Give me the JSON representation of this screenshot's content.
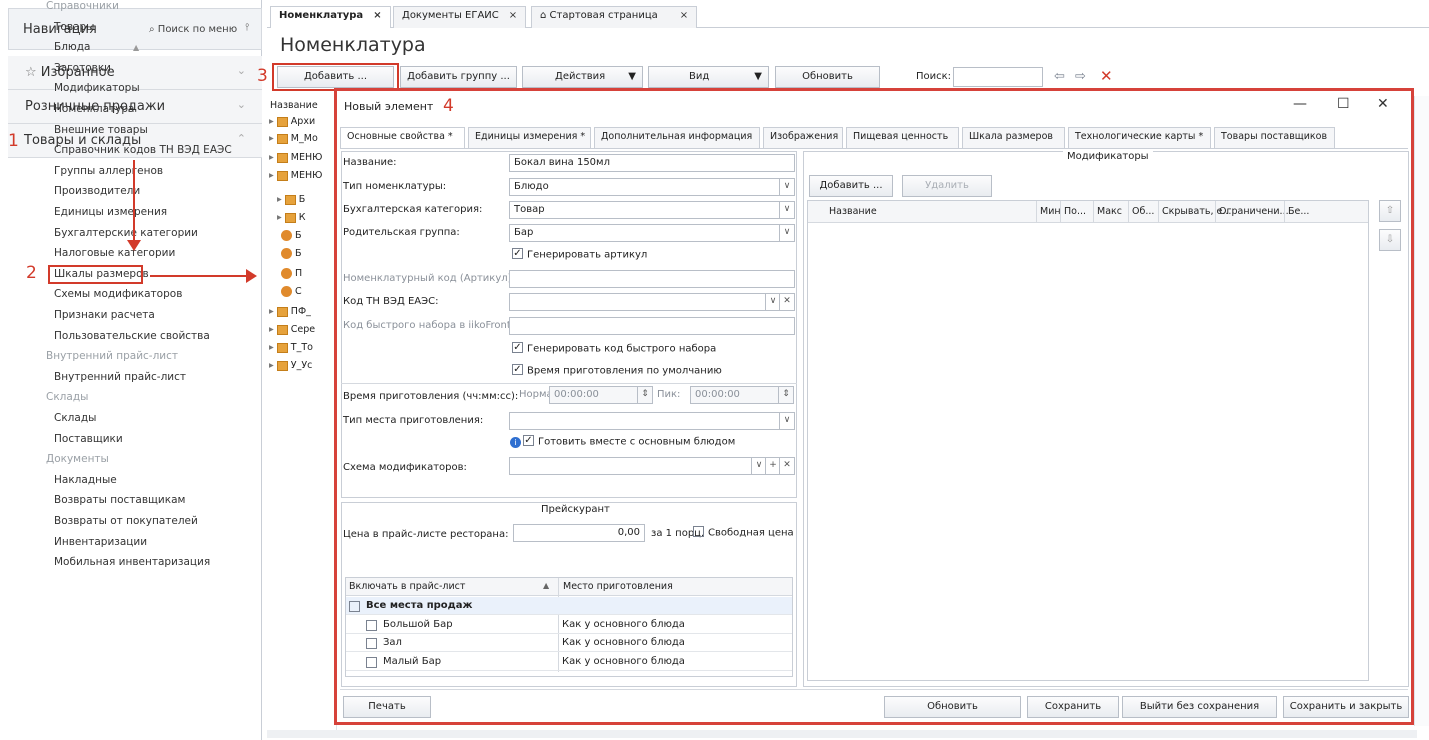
{
  "nav": {
    "title": "Навигация",
    "search": "Поиск по меню",
    "favorites": "Избранное",
    "retail": "Розничные продажи",
    "goods": "Товары и склады",
    "items": [
      {
        "label": "Справочники",
        "group": true
      },
      {
        "label": "Товары"
      },
      {
        "label": "Блюда"
      },
      {
        "label": "Заготовки"
      },
      {
        "label": "Модификаторы"
      },
      {
        "label": "Номенклатура"
      },
      {
        "label": "Внешние товары"
      },
      {
        "label": "Справочник кодов ТН ВЭД ЕАЭС"
      },
      {
        "label": "Группы аллергенов"
      },
      {
        "label": "Производители"
      },
      {
        "label": "Единицы измерения"
      },
      {
        "label": "Бухгалтерские категории"
      },
      {
        "label": "Налоговые категории"
      },
      {
        "label": "Шкалы размеров"
      },
      {
        "label": "Схемы модификаторов"
      },
      {
        "label": "Признаки расчета"
      },
      {
        "label": "Пользовательские свойства"
      },
      {
        "label": "Внутренний прайс-лист",
        "group": true
      },
      {
        "label": "Внутренний прайс-лист"
      },
      {
        "label": "Склады",
        "group": true
      },
      {
        "label": "Склады"
      },
      {
        "label": "Поставщики"
      },
      {
        "label": "Документы",
        "group": true
      },
      {
        "label": "Накладные"
      },
      {
        "label": "Возвраты поставщикам"
      },
      {
        "label": "Возвраты от покупателей"
      },
      {
        "label": "Инвентаризации"
      },
      {
        "label": "Мобильная инвентаризация"
      }
    ]
  },
  "annotations": {
    "n1": "1",
    "n2": "2",
    "n3": "3",
    "n4": "4"
  },
  "tabs": [
    "Номенклатура",
    "Документы ЕГАИС",
    "Стартовая страница"
  ],
  "tab_close": "×",
  "page_title": "Номенклатура",
  "toolbar": {
    "add": "Добавить ...",
    "add_group": "Добавить группу ...",
    "actions": "Действия",
    "view": "Вид",
    "refresh": "Обновить",
    "search_label": "Поиск:"
  },
  "tree": {
    "header": "Название",
    "rows": [
      "Архи",
      "М_Мо",
      "МЕНЮ",
      "МЕНЮ",
      "Б",
      "К",
      "Б",
      "Б",
      "П",
      "С",
      "ПФ_",
      "Сере",
      "Т_То",
      "У_Ус"
    ]
  },
  "dialog": {
    "title": "Новый элемент",
    "controls": {
      "min": "—",
      "max": "☐",
      "close": "✕"
    },
    "tabs": [
      "Основные свойства *",
      "Единицы измерения *",
      "Дополнительная информация",
      "Изображения",
      "Пищевая ценность",
      "Шкала размеров",
      "Технологические карты *",
      "Товары поставщиков"
    ],
    "fields": {
      "name_label": "Название:",
      "name_value": "Бокал вина 150мл",
      "type_label": "Тип номенклатуры:",
      "type_value": "Блюдо",
      "acc_label": "Бухгалтерская категория:",
      "acc_value": "Товар",
      "parent_label": "Родительская группа:",
      "parent_value": "Бар",
      "gen_article": "Генерировать артикул",
      "code_label": "Номенклатурный код (Артикул):",
      "tnved_label": "Код ТН ВЭД ЕАЭС:",
      "fast_label": "Код быстрого набора в iikoFront:",
      "gen_fast": "Генерировать код быстрого набора",
      "default_time": "Время приготовления по умолчанию",
      "cook_time_label": "Время приготовления (чч:мм:сс):",
      "norm_label": "Норма:",
      "norm_value": "00:00:00",
      "peak_label": "Пик:",
      "peak_value": "00:00:00",
      "place_type_label": "Тип места приготовления:",
      "cook_with_main": "Готовить вместе с основным блюдом",
      "mod_scheme_label": "Схема модификаторов:"
    },
    "price": {
      "section": "Прейскурант",
      "label": "Цена в прайс-листе ресторана:",
      "value": "0,00",
      "unit": "за 1 порц.",
      "free": "Свободная цена",
      "col1": "Включать в прайс-лист",
      "col2": "Место приготовления",
      "rows": [
        {
          "name": "Все места продаж",
          "place": ""
        },
        {
          "name": "Большой Бар",
          "place": "Как у основного блюда"
        },
        {
          "name": "Зал",
          "place": "Как у основного блюда"
        },
        {
          "name": "Малый Бар",
          "place": "Как у основного блюда"
        }
      ]
    },
    "modifiers": {
      "section": "Модификаторы",
      "add": "Добавить ...",
      "delete": "Удалить",
      "cols": [
        "Название",
        "Мин",
        "По...",
        "Макс",
        "Об...",
        "Скрывать, е...",
        "Ограничени...",
        "Бе..."
      ]
    },
    "buttons": {
      "print": "Печать",
      "refresh": "Обновить",
      "save": "Сохранить",
      "exit_no_save": "Выйти без сохранения",
      "save_close": "Сохранить и закрыть"
    }
  },
  "colors": {
    "accent_red": "#d23a2a",
    "folder": "#e6a23c"
  }
}
